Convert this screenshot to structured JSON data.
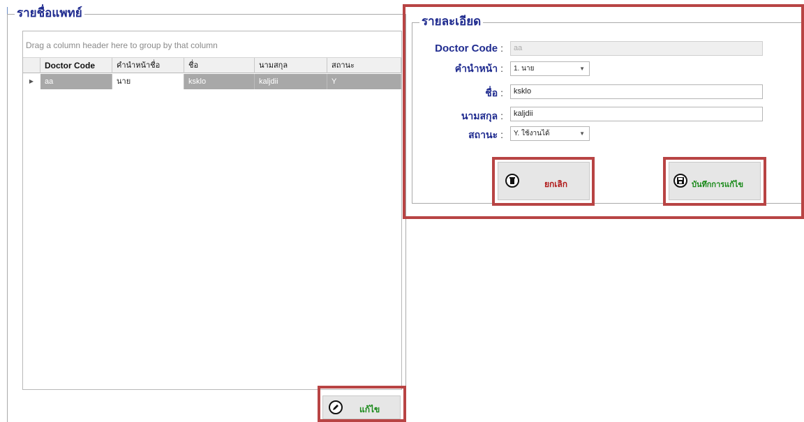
{
  "left_panel": {
    "title": "รายชื่อแพทย์",
    "group_hint": "Drag a column header here to group by that column",
    "columns": [
      "Doctor Code",
      "คำนำหน้าชื่อ",
      "ชื่อ",
      "นามสกุล",
      "สถานะ"
    ],
    "rows": [
      {
        "code": "aa",
        "prefix": "นาย",
        "first_name": "ksklo",
        "last_name": "kaljdii",
        "status": "Y"
      }
    ],
    "edit_button": "แก้ไข"
  },
  "right_panel": {
    "title": "รายละเอียด",
    "labels": {
      "doctor_code": "Doctor Code",
      "prefix": "คำนำหน้า",
      "first_name": "ชื่อ",
      "last_name": "นามสกุล",
      "status": "สถานะ",
      "colon": ":"
    },
    "values": {
      "doctor_code": "aa",
      "prefix": "1. นาย",
      "first_name": "ksklo",
      "last_name": "kaljdii",
      "status": "Y. ใช้งานได้"
    },
    "cancel_button": "ยกเลิก",
    "save_button": "บันทึกการแก้ไข"
  },
  "colors": {
    "title": "#1f2b8f",
    "highlight_border": "#b84444",
    "cancel_text": "#b01818",
    "save_text": "#1a8a1a",
    "selected_row": "#a8a8a8"
  }
}
